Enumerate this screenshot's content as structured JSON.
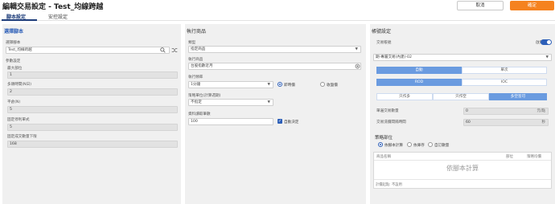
{
  "header": {
    "title": "編輯交易設定 - Test_均線跨越",
    "cancel_label": "取消",
    "confirm_label": "確定"
  },
  "tabs": [
    {
      "label": "腳本設定",
      "active": true
    },
    {
      "label": "安控設定",
      "active": false
    }
  ],
  "script_panel": {
    "heading": "選擇腳本",
    "script_label": "選擇腳本",
    "script_value": "Test_均線跨越",
    "params_label": "參數設定",
    "params": [
      {
        "label": "最大部位",
        "value": "1"
      },
      {
        "label": "多頭時間(N日)",
        "value": "2"
      },
      {
        "label": "平倉(N)",
        "value": "5"
      },
      {
        "label": "固定停利單式",
        "value": "5"
      },
      {
        "label": "固定成交數量下限",
        "value": "168"
      }
    ]
  },
  "product_panel": {
    "heading": "執行商品",
    "type_label": "類型",
    "type_value": "指定商品",
    "product_label": "執行商品",
    "product_value": "台股指數近月",
    "freq_label": "執行頻率",
    "freq_value": "1分鐘",
    "radio_1": "即時價",
    "radio_2": "收盤價",
    "setting_label": "策略單位(計算週期)",
    "setting_value": "不指定",
    "bars_label": "資料讀取筆數",
    "bars_value": "100",
    "auto_label": "自動決定"
  },
  "order_panel": {
    "heading": "帳號設定",
    "account_label": "交易帳號",
    "enable_label": "啟用",
    "account_value": "期-專屬交易(內建)-02",
    "seg_row1": [
      "自動",
      "單次"
    ],
    "seg_row2": [
      "ROD",
      "IOC"
    ],
    "seg_row3": [
      "只作多",
      "只作空",
      "多空皆可"
    ],
    "seg_row3_active": 2,
    "price_label": "單邊交易數量",
    "price_value": "0",
    "price_unit": "元/點",
    "delay_label": "交易洗價間隔時間",
    "delay_value": "60",
    "delay_unit": "秒",
    "strategy_heading": "策略部位",
    "strategy_radios": [
      "依腳本計算",
      "依庫存",
      "自訂數量"
    ],
    "table_headers": [
      "商品名稱",
      "部位",
      "策略均價"
    ],
    "empty_text": "依腳本計算",
    "footer_text": "計價起點: 不設用"
  }
}
